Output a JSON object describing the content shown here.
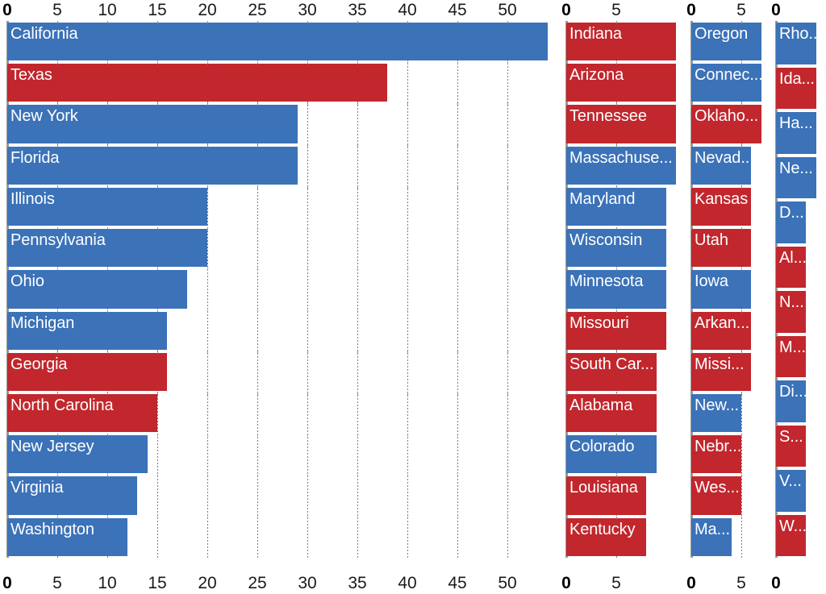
{
  "chart_data": {
    "type": "bar",
    "orientation": "horizontal",
    "title": "",
    "xlabel": "",
    "ylabel": "",
    "grid": true,
    "legend": null,
    "colors": {
      "blue": "#3b72b8",
      "red": "#c1272d",
      "axis": "#9a9a9a",
      "gridline": "#7d7d7d",
      "label_text": "#ffffff",
      "tick_text": "#1a1a1a"
    },
    "panels": [
      {
        "name": "panel-1",
        "xlim": [
          0,
          54.5
        ],
        "ticks_top": [
          "0",
          "5",
          "10",
          "15",
          "20",
          "25",
          "30",
          "35",
          "40",
          "45",
          "50"
        ],
        "ticks_bottom": [
          "0",
          "5",
          "10",
          "15",
          "20",
          "25",
          "30",
          "35",
          "40",
          "45",
          "50"
        ],
        "tick_values": [
          0,
          5,
          10,
          15,
          20,
          25,
          30,
          35,
          40,
          45,
          50
        ],
        "bars": [
          {
            "label": "California",
            "value": 54,
            "color": "blue"
          },
          {
            "label": "Texas",
            "value": 38,
            "color": "red"
          },
          {
            "label": "New York",
            "value": 29,
            "color": "blue"
          },
          {
            "label": "Florida",
            "value": 29,
            "color": "blue"
          },
          {
            "label": "Illinois",
            "value": 20,
            "color": "blue"
          },
          {
            "label": "Pennsylvania",
            "value": 20,
            "color": "blue"
          },
          {
            "label": "Ohio",
            "value": 18,
            "color": "blue"
          },
          {
            "label": "Michigan",
            "value": 16,
            "color": "blue"
          },
          {
            "label": "Georgia",
            "value": 16,
            "color": "red"
          },
          {
            "label": "North Carolina",
            "value": 15,
            "color": "red"
          },
          {
            "label": "New Jersey",
            "value": 14,
            "color": "blue"
          },
          {
            "label": "Virginia",
            "value": 13,
            "color": "blue"
          },
          {
            "label": "Washington",
            "value": 12,
            "color": "blue"
          }
        ]
      },
      {
        "name": "panel-2",
        "xlim": [
          0,
          11.6
        ],
        "ticks_top": [
          "0",
          "5"
        ],
        "ticks_bottom": [
          "0",
          "5"
        ],
        "tick_values": [
          0,
          5
        ],
        "bars": [
          {
            "label": "Indiana",
            "value": 11,
            "color": "red"
          },
          {
            "label": "Arizona",
            "value": 11,
            "color": "red"
          },
          {
            "label": "Tennessee",
            "value": 11,
            "color": "red"
          },
          {
            "label": "Massachuse...",
            "value": 11,
            "color": "blue"
          },
          {
            "label": "Maryland",
            "value": 10,
            "color": "blue"
          },
          {
            "label": "Wisconsin",
            "value": 10,
            "color": "blue"
          },
          {
            "label": "Minnesota",
            "value": 10,
            "color": "blue"
          },
          {
            "label": "Missouri",
            "value": 10,
            "color": "red"
          },
          {
            "label": "South Car...",
            "value": 9,
            "color": "red"
          },
          {
            "label": "Alabama",
            "value": 9,
            "color": "red"
          },
          {
            "label": "Colorado",
            "value": 9,
            "color": "blue"
          },
          {
            "label": "Louisiana",
            "value": 8,
            "color": "red"
          },
          {
            "label": "Kentucky",
            "value": 8,
            "color": "red"
          }
        ]
      },
      {
        "name": "panel-3",
        "xlim": [
          0,
          7.6
        ],
        "ticks_top": [
          "0",
          "5"
        ],
        "ticks_bottom": [
          "0",
          "5"
        ],
        "tick_values": [
          0,
          5
        ],
        "bars": [
          {
            "label": "Oregon",
            "value": 7,
            "color": "blue"
          },
          {
            "label": "Connec...",
            "value": 7,
            "color": "blue"
          },
          {
            "label": "Oklaho...",
            "value": 7,
            "color": "red"
          },
          {
            "label": "Nevad...",
            "value": 6,
            "color": "blue"
          },
          {
            "label": "Kansas",
            "value": 6,
            "color": "red"
          },
          {
            "label": "Utah",
            "value": 6,
            "color": "red"
          },
          {
            "label": "Iowa",
            "value": 6,
            "color": "blue"
          },
          {
            "label": "Arkan...",
            "value": 6,
            "color": "red"
          },
          {
            "label": "Missi...",
            "value": 6,
            "color": "red"
          },
          {
            "label": "New...",
            "value": 5,
            "color": "blue"
          },
          {
            "label": "Nebr...",
            "value": 5,
            "color": "red"
          },
          {
            "label": "Wes...",
            "value": 5,
            "color": "red"
          },
          {
            "label": "Ma...",
            "value": 4,
            "color": "blue"
          }
        ]
      },
      {
        "name": "panel-4",
        "xlim": [
          0,
          4.9
        ],
        "ticks_top": [
          "0"
        ],
        "ticks_bottom": [
          "0"
        ],
        "tick_values": [
          0
        ],
        "bars": [
          {
            "label": "Rho...",
            "value": 4,
            "color": "blue"
          },
          {
            "label": "Ida...",
            "value": 4,
            "color": "red"
          },
          {
            "label": "Ha...",
            "value": 4,
            "color": "blue"
          },
          {
            "label": "Ne...",
            "value": 4,
            "color": "blue"
          },
          {
            "label": "D...",
            "value": 3,
            "color": "blue"
          },
          {
            "label": "Al...",
            "value": 3,
            "color": "red"
          },
          {
            "label": "N...",
            "value": 3,
            "color": "red"
          },
          {
            "label": "M...",
            "value": 3,
            "color": "red"
          },
          {
            "label": "Di...",
            "value": 3,
            "color": "blue"
          },
          {
            "label": "S...",
            "value": 3,
            "color": "red"
          },
          {
            "label": "V...",
            "value": 3,
            "color": "blue"
          },
          {
            "label": "W...",
            "value": 3,
            "color": "red"
          }
        ]
      }
    ]
  }
}
